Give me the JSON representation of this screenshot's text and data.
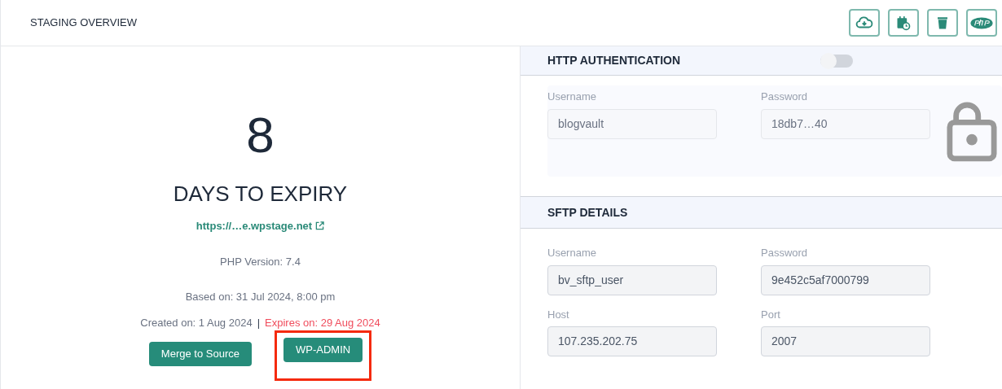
{
  "header": {
    "title": "STAGING OVERVIEW",
    "actions": [
      {
        "kind": "backup"
      },
      {
        "kind": "schedule"
      },
      {
        "kind": "delete"
      },
      {
        "kind": "php"
      }
    ]
  },
  "summary": {
    "days": "8",
    "days_label": "DAYS TO EXPIRY",
    "url": "https://…e.wpstage.net",
    "php_version": "PHP Version: 7.4",
    "based_on": "Based on: 31 Jul 2024, 8:00 pm",
    "created_on": "Created on: 1 Aug 2024",
    "separator": "|",
    "expires_on": "Expires on: 29 Aug 2024",
    "buttons": [
      {
        "label": "Merge to Source",
        "highlighted": false
      },
      {
        "label": "WP-ADMIN",
        "highlighted": true
      }
    ]
  },
  "http_authentication": {
    "title": "HTTP AUTHENTICATION",
    "on": false,
    "fields": [
      {
        "label": "Username",
        "value": "blogvault"
      },
      {
        "label": "Password",
        "value": "18db7…40"
      }
    ]
  },
  "sftp_details": {
    "title": "SFTP DETAILS",
    "fields": [
      {
        "label": "Username",
        "value": "bv_sftp_user"
      },
      {
        "label": "Password",
        "value": "9e452c5af7000799"
      },
      {
        "label": "Host",
        "value": "107.235.202.75"
      },
      {
        "label": "Port",
        "value": "2007"
      }
    ]
  }
}
